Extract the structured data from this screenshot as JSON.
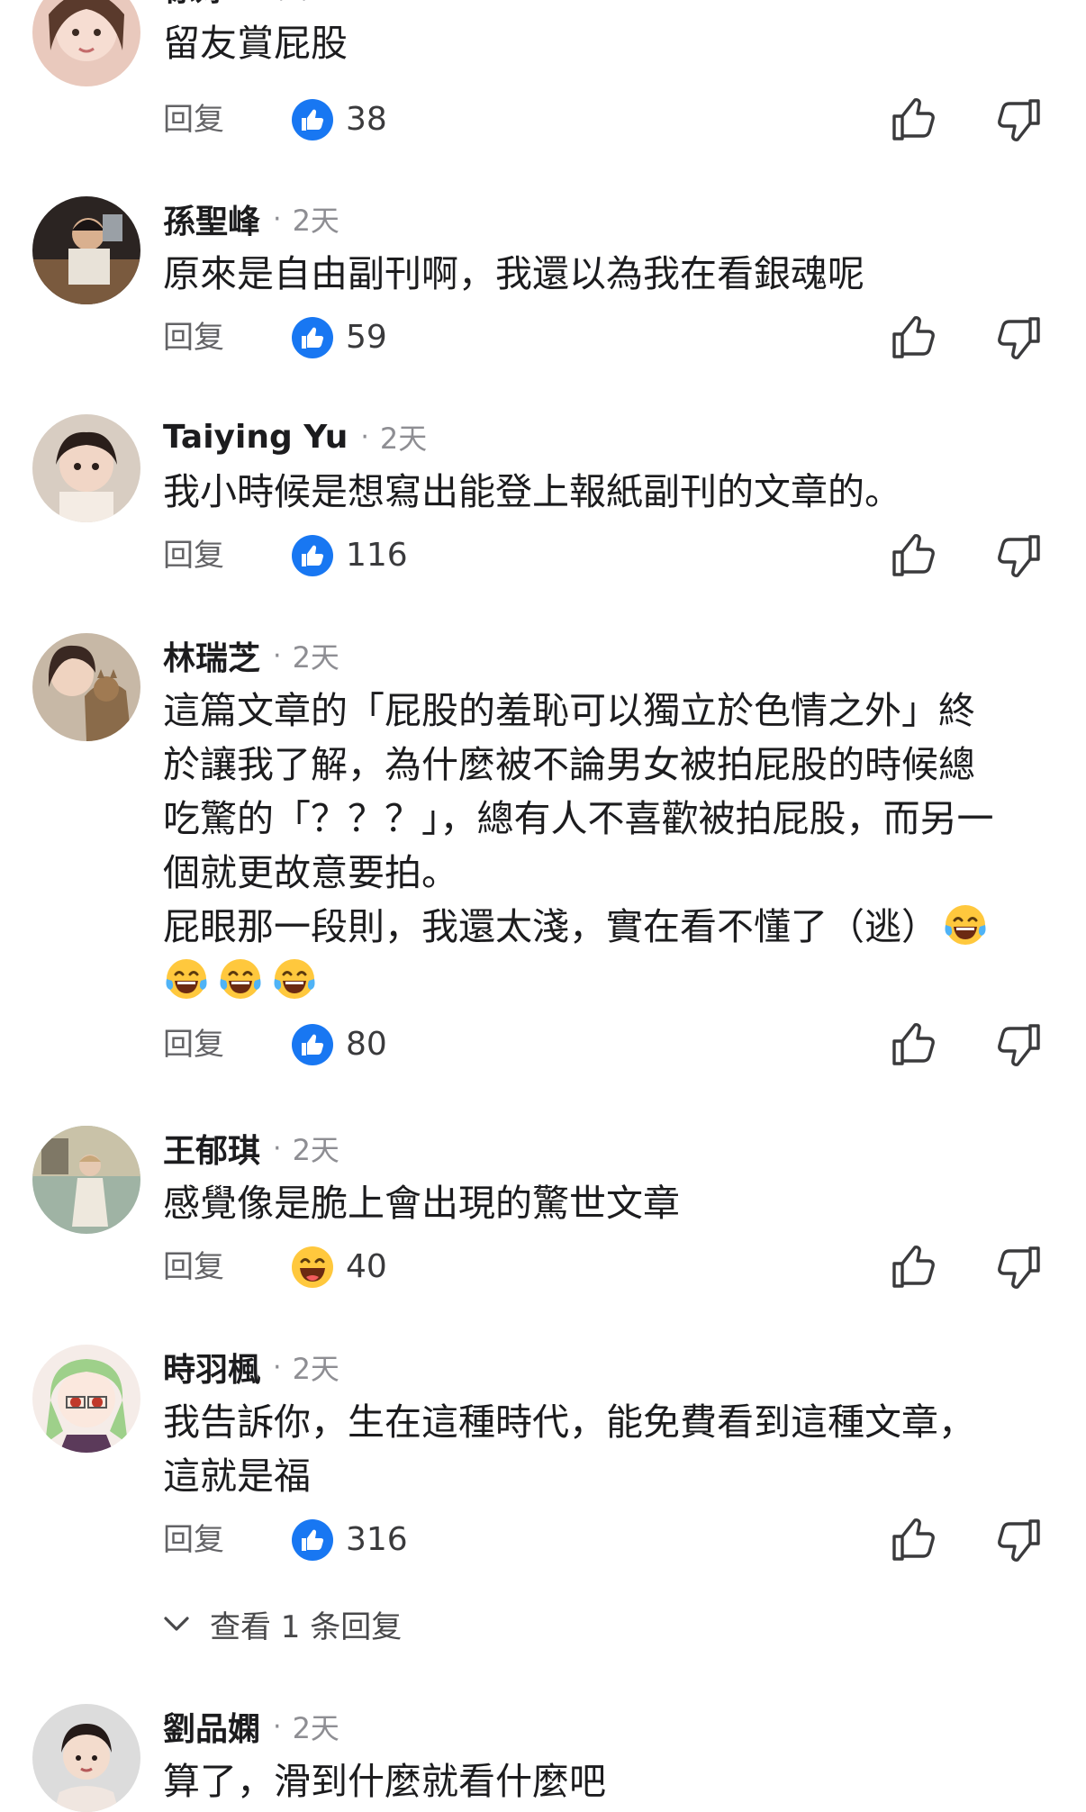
{
  "comments": [
    {
      "name": "徐婷",
      "time": "2天",
      "lines": [
        "留友賞屁股"
      ],
      "reply_label": "回复",
      "reaction": "like",
      "likes": "38"
    },
    {
      "name": "孫聖峰",
      "time": "2天",
      "lines": [
        "原來是自由副刊啊，我還以為我在看銀魂呢"
      ],
      "reply_label": "回复",
      "reaction": "like",
      "likes": "59"
    },
    {
      "name": "Taiying Yu",
      "time": "2天",
      "lines": [
        "我小時候是想寫出能登上報紙副刊的文章的。"
      ],
      "reply_label": "回复",
      "reaction": "like",
      "likes": "116"
    },
    {
      "name": "林瑞芝",
      "time": "2天",
      "lines": [
        "這篇文章的「屁股的羞恥可以獨立於色情之外」終",
        "於讓我了解，為什麼被不論男女被拍屁股的時候總",
        "吃驚的「？？？」，總有人不喜歡被拍屁股，而另一",
        "個就更故意要拍。",
        "屁眼那一段則，我還太淺，實在看不懂了（逃）"
      ],
      "emoji_name": "laughing-tears-emoji",
      "reply_label": "回复",
      "reaction": "like",
      "likes": "80"
    },
    {
      "name": "王郁琪",
      "time": "2天",
      "lines": [
        "感覺像是脆上會出現的驚世文章"
      ],
      "reply_label": "回复",
      "reaction": "haha",
      "likes": "40"
    },
    {
      "name": "時羽楓",
      "time": "2天",
      "lines": [
        "我告訴你，生在這種時代，能免費看到這種文章，",
        "這就是福"
      ],
      "reply_label": "回复",
      "reaction": "like",
      "likes": "316",
      "view_replies": "查看 1 条回复"
    },
    {
      "name": "劉品嫻",
      "time": "2天",
      "lines": [
        "算了，滑到什麼就看什麼吧"
      ]
    }
  ],
  "icons": {
    "like_reaction": "blue-thumbs-up-icon",
    "haha_reaction": "grinning-face-icon",
    "like_button": "thumbs-up-outline-icon",
    "dislike_button": "thumbs-down-outline-icon",
    "expand": "chevron-down-icon"
  },
  "colors": {
    "like_blue": "#1877F2",
    "emoji_yellow": "#FFC83D",
    "text": "#1c1c1e",
    "muted": "#8e8e93"
  }
}
